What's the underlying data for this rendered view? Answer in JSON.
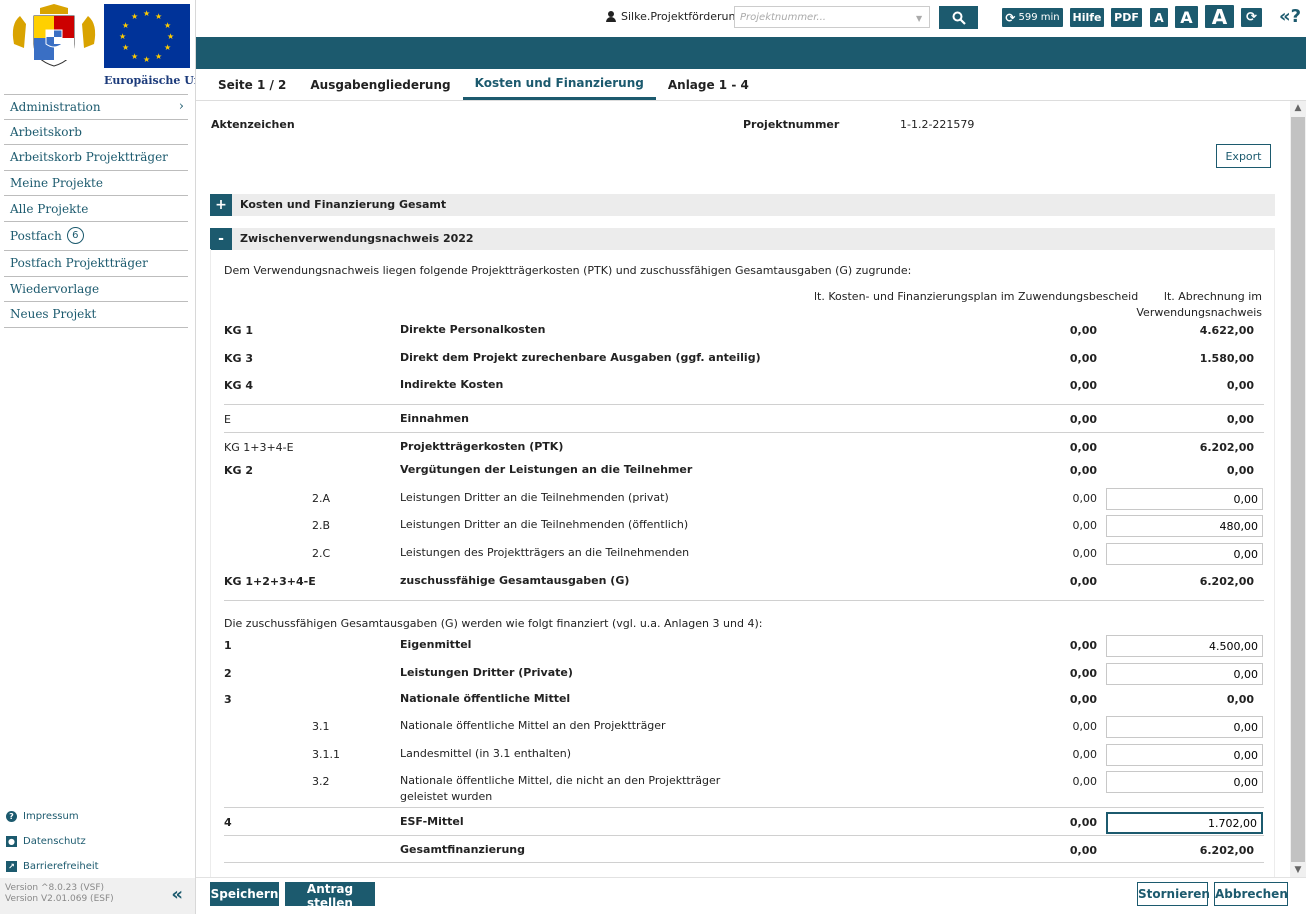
{
  "brand": {
    "eu_label": "Europäische Union"
  },
  "sidebar": {
    "items": [
      {
        "label": "Administration"
      },
      {
        "label": "Arbeitskorb"
      },
      {
        "label": "Arbeitskorb Projektträger"
      },
      {
        "label": "Meine Projekte"
      },
      {
        "label": "Alle Projekte"
      },
      {
        "label": "Postfach",
        "badge": "6"
      },
      {
        "label": "Postfach Projektträger"
      },
      {
        "label": "Wiedervorlage"
      },
      {
        "label": "Neues Projekt"
      }
    ],
    "footer": [
      {
        "label": "Impressum",
        "icon": "question-circle-icon"
      },
      {
        "label": "Datenschutz",
        "icon": "user-shield-icon"
      },
      {
        "label": "Barrierefreiheit",
        "icon": "accessibility-icon"
      }
    ],
    "version_lines": [
      "Version ^8.0.23 (VSF)",
      "Version V2.01.069 (ESF)"
    ]
  },
  "topbar": {
    "user": "Silke.Projektförderung",
    "search_placeholder": "Projektnummer...",
    "session_timer": "599 min",
    "help": "Hilfe",
    "pdf": "PDF",
    "font_small": "A",
    "font_medium": "A",
    "font_large": "A"
  },
  "tabs": [
    {
      "label": "Seite 1 / 2",
      "active": false
    },
    {
      "label": "Ausgabengliederung",
      "active": false
    },
    {
      "label": "Kosten und Finanzierung",
      "active": true
    },
    {
      "label": "Anlage 1 - 4",
      "active": false
    }
  ],
  "header_fields": {
    "aktenzeichen_label": "Aktenzeichen",
    "projektnummer_label": "Projektnummer",
    "projektnummer_value": "1-1.2-221579",
    "export": "Export"
  },
  "sections": {
    "gesamt": {
      "toggle": "+",
      "title": "Kosten und Finanzierung Gesamt"
    },
    "zwn": {
      "toggle": "-",
      "title": "Zwischenverwendungsnachweis 2022"
    }
  },
  "zwn": {
    "intro": "Dem Verwendungsnachweis liegen folgende Projektträgerkosten (PTK) und zuschussfähigen Gesamtausgaben (G) zugrunde:",
    "col_plan": "lt. Kosten- und Finanzierungsplan im Zuwendungsbescheid",
    "col_acct_1": "lt. Abrechnung im",
    "col_acct_2": "Verwendungsnachweis",
    "cost_rows": [
      {
        "kg": "KG 1",
        "sub": "",
        "desc": "Direkte Personalkosten",
        "plan": "0,00",
        "acct": "4.622,00"
      },
      {
        "kg": "KG 3",
        "sub": "",
        "desc": "Direkt dem Projekt zurechenbare Ausgaben (ggf. anteilig)",
        "plan": "0,00",
        "acct": "1.580,00"
      },
      {
        "kg": "KG 4",
        "sub": "",
        "desc": "Indirekte Kosten",
        "plan": "0,00",
        "acct": "0,00"
      },
      {
        "kg": "E",
        "sub": "",
        "desc": "Einnahmen",
        "plan": "0,00",
        "acct": "0,00"
      },
      {
        "kg": "KG 1+3+4-E",
        "sub": "",
        "desc": "Projektträgerkosten (PTK)",
        "plan": "0,00",
        "acct": "6.202,00"
      },
      {
        "kg": "KG 2",
        "sub": "",
        "desc": "Vergütungen der Leistungen an die Teilnehmer",
        "plan": "0,00",
        "acct": "0,00"
      },
      {
        "kg": "",
        "sub": "2.A",
        "desc": "Leistungen Dritter an die Teilnehmenden (privat)",
        "plan": "0,00",
        "input": "0,00"
      },
      {
        "kg": "",
        "sub": "2.B",
        "desc": "Leistungen Dritter an die Teilnehmenden (öffentlich)",
        "plan": "0,00",
        "input": "480,00"
      },
      {
        "kg": "",
        "sub": "2.C",
        "desc": "Leistungen des Projektträgers an die Teilnehmenden",
        "plan": "0,00",
        "input": "0,00"
      },
      {
        "kg": "KG 1+2+3+4-E",
        "sub": "",
        "desc": "zuschussfähige Gesamtausgaben (G)",
        "plan": "0,00",
        "acct": "6.202,00"
      }
    ],
    "finance_intro": "Die zuschussfähigen Gesamtausgaben (G) werden wie folgt finanziert (vgl. u.a. Anlagen 3 und 4):",
    "finance_rows": [
      {
        "kg": "1",
        "sub": "",
        "desc": "Eigenmittel",
        "plan": "0,00",
        "input": "4.500,00"
      },
      {
        "kg": "2",
        "sub": "",
        "desc": "Leistungen Dritter (Private)",
        "plan": "0,00",
        "input": "0,00"
      },
      {
        "kg": "3",
        "sub": "",
        "desc": "Nationale öffentliche Mittel",
        "plan": "0,00",
        "acct": "0,00"
      },
      {
        "kg": "",
        "sub": "3.1",
        "desc": "Nationale öffentliche Mittel an den Projektträger",
        "plan": "0,00",
        "input": "0,00"
      },
      {
        "kg": "",
        "sub": "3.1.1",
        "desc": "Landesmittel (in 3.1 enthalten)",
        "plan": "0,00",
        "input": "0,00"
      },
      {
        "kg": "",
        "sub": "3.2",
        "desc": "Nationale öffentliche Mittel, die nicht an den Projektträger geleistet wurden",
        "plan": "0,00",
        "input": "0,00"
      },
      {
        "kg": "4",
        "sub": "",
        "desc": "ESF-Mittel",
        "plan": "0,00",
        "input": "1.702,00"
      },
      {
        "kg": "",
        "sub": "",
        "desc": "Gesamtfinanzierung",
        "plan": "0,00",
        "acct": "6.202,00"
      }
    ]
  },
  "bottombar": {
    "save": "Speichern",
    "submit": "Antrag stellen",
    "cancel_storno": "Stornieren",
    "abort": "Abbrechen"
  },
  "colors": {
    "accent": "#1c5a6e"
  }
}
